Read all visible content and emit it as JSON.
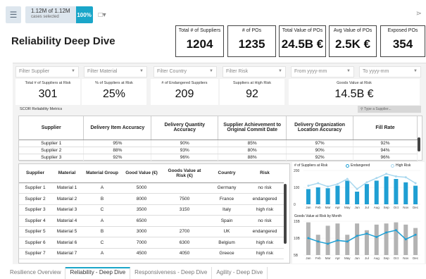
{
  "topbar": {
    "cases_count": "1.12M of 1.12M",
    "cases_label": "cases selected",
    "percent": "100%"
  },
  "title": "Reliability Deep Dive",
  "kpis": [
    {
      "label": "Total # of Suppliers",
      "value": "1204"
    },
    {
      "label": "# of POs",
      "value": "1235"
    },
    {
      "label": "Total Value of POs",
      "value": "24.5B €"
    },
    {
      "label": "Avg Value of POs",
      "value": "2.5K €"
    },
    {
      "label": "Exposed POs",
      "value": "354"
    }
  ],
  "filters": [
    {
      "label": "Filter Supplier"
    },
    {
      "label": "Filter Material"
    },
    {
      "label": "Filter Country"
    },
    {
      "label": "Filter Risk"
    },
    {
      "label": "From yyyy-mm"
    },
    {
      "label": "To yyyy-mm"
    }
  ],
  "mini_kpis": [
    {
      "label": "Total # of Suppliers at Risk",
      "value": "301"
    },
    {
      "label": "% of Suppliers at Risk",
      "value": "25%"
    },
    {
      "label": "# of Endangered Suppliers",
      "value": "209"
    },
    {
      "label": "Suppliers at High Risk",
      "value": "92"
    },
    {
      "label": "Goods Value at Risk",
      "value": "14.5B €"
    }
  ],
  "scor": {
    "title": "SCOR Reliability Metrics",
    "search_placeholder": "Type a Supplier...",
    "headers": [
      "Supplier",
      "Delivery Item Accuracy",
      "Delivery Quantity Accuracy",
      "Supplier Achievement to Original Commit Date",
      "Delivery Organization Location Accuracy",
      "Fill Rate"
    ],
    "rows": [
      [
        "Supplier 1",
        "95%",
        "90%",
        "85%",
        "97%",
        "92%"
      ],
      [
        "Supplier 2",
        "88%",
        "93%",
        "80%",
        "90%",
        "94%"
      ],
      [
        "Supplier 3",
        "92%",
        "96%",
        "88%",
        "92%",
        "96%"
      ]
    ]
  },
  "detail": {
    "headers": [
      "Supplier",
      "Material",
      "Material Group",
      "Good Value (€)",
      "Goods Value at Risk (€)",
      "Country",
      "Risk"
    ],
    "rows": [
      [
        "Supplier 1",
        "Material 1",
        "A",
        "5000",
        "",
        "Germany",
        "no risk"
      ],
      [
        "Supplier 2",
        "Material 2",
        "B",
        "8000",
        "7500",
        "France",
        "endangered"
      ],
      [
        "Supplier 3",
        "Material 3",
        "C",
        "3500",
        "3150",
        "Italy",
        "high risk"
      ],
      [
        "Supplier 4",
        "Material 4",
        "A",
        "6500",
        "",
        "Spain",
        "no risk"
      ],
      [
        "Supplier 5",
        "Material 5",
        "B",
        "3000",
        "2700",
        "UK",
        "endangered"
      ],
      [
        "Supplier 6",
        "Material 6",
        "C",
        "7000",
        "6300",
        "Belgium",
        "high risk"
      ],
      [
        "Supplier 7",
        "Material 7",
        "A",
        "4500",
        "4050",
        "Greece",
        "high risk"
      ]
    ]
  },
  "tabs": [
    {
      "label": "Resilience Overview",
      "active": false
    },
    {
      "label": "Reliability - Deep Dive",
      "active": true
    },
    {
      "label": "Responsiveness - Deep Dive",
      "active": false
    },
    {
      "label": "Agility - Deep Dive",
      "active": false
    }
  ],
  "chart_data": [
    {
      "type": "bar",
      "title": "# of Suppliers at Risk",
      "categories": [
        "Jan",
        "Feb",
        "Mar",
        "Apr",
        "May",
        "Jun",
        "Jul",
        "Aug",
        "Sep",
        "Oct",
        "Nov",
        "Dec"
      ],
      "ylim": [
        0,
        200
      ],
      "yticks": [
        "200",
        "100",
        "0"
      ],
      "colors": {
        "endangered": "#1f9fd3",
        "high_risk": "#a9d8ef"
      },
      "series": [
        {
          "name": "Endangered",
          "values": [
            90,
            100,
            95,
            110,
            140,
            75,
            120,
            140,
            165,
            150,
            130,
            110
          ]
        },
        {
          "name": "High Risk",
          "values": [
            110,
            125,
            105,
            120,
            150,
            90,
            130,
            155,
            180,
            165,
            160,
            125
          ]
        }
      ]
    },
    {
      "type": "bar",
      "title": "Goods Value at Risk by Month",
      "categories": [
        "Jan",
        "Feb",
        "Mar",
        "Apr",
        "May",
        "Jun",
        "Jul",
        "Aug",
        "Sep",
        "Oct",
        "Nov",
        "Dec"
      ],
      "ylim": [
        0,
        15
      ],
      "yticks": [
        "15B",
        "10B",
        "5B"
      ],
      "colors": {
        "bars": "#b3b3b3",
        "line": "#1f9fd3"
      },
      "series": [
        {
          "name": "Bars",
          "values": [
            14.5,
            9,
            13,
            14,
            9,
            14,
            11,
            13.5,
            14,
            14.5,
            13.5,
            12
          ]
        },
        {
          "name": "Line",
          "values": [
            7.5,
            6,
            5,
            6.5,
            6,
            8.5,
            9.5,
            8,
            10,
            11,
            7,
            9
          ]
        }
      ]
    }
  ]
}
